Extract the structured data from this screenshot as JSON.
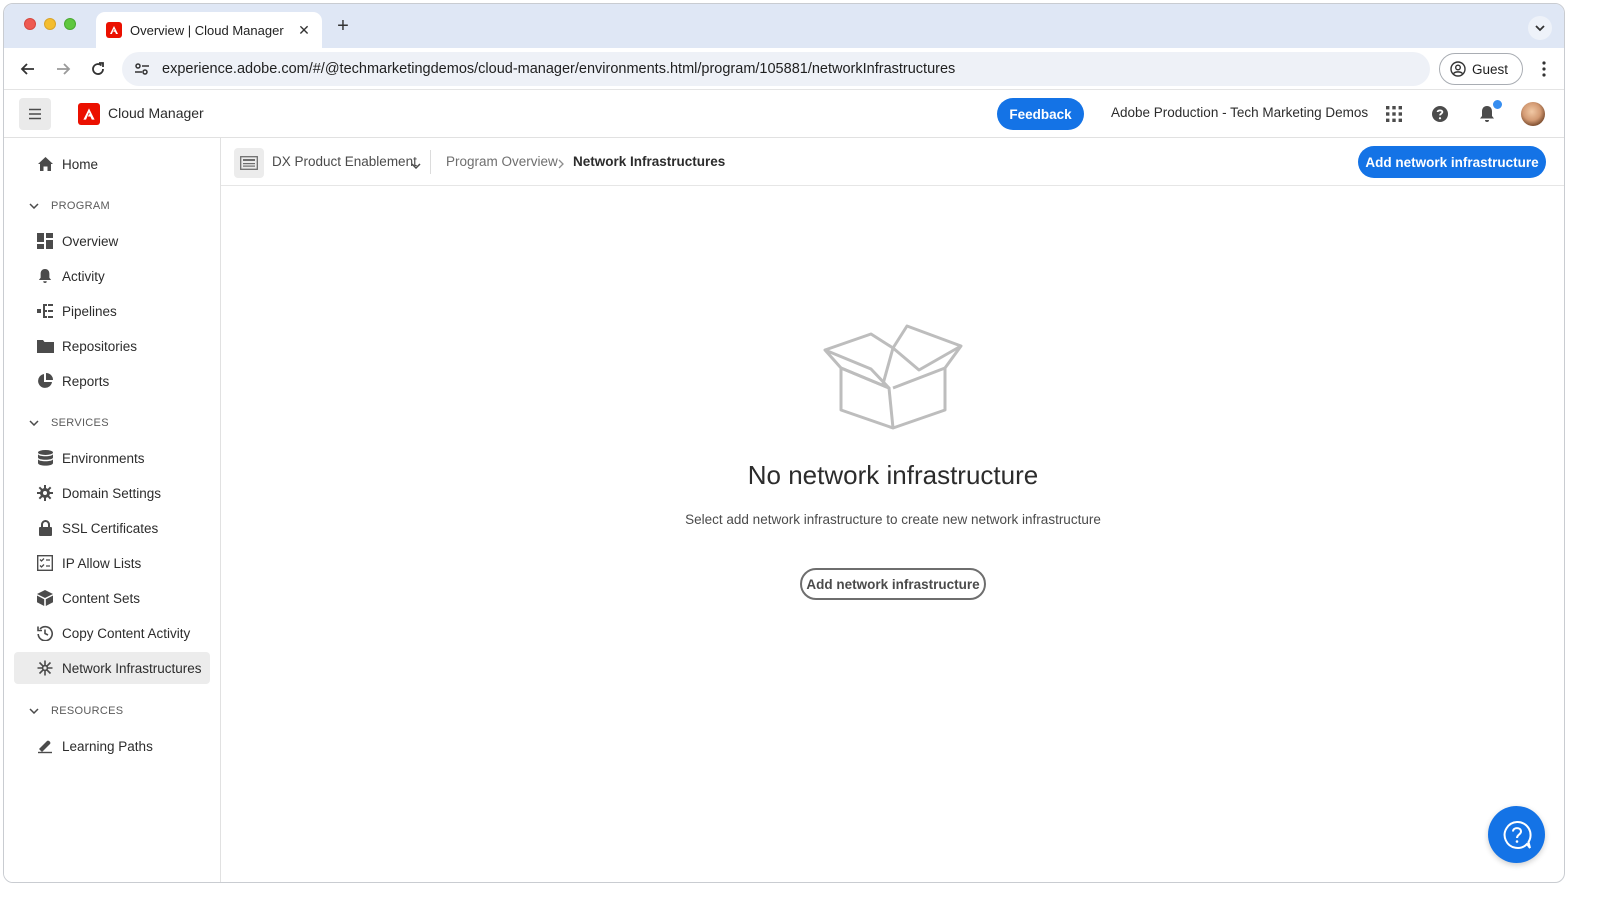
{
  "browser": {
    "tab_title": "Overview | Cloud Manager",
    "url": "experience.adobe.com/#/@techmarketingdemos/cloud-manager/environments.html/program/105881/networkInfrastructures",
    "profile_label": "Guest"
  },
  "header": {
    "brand": "Cloud Manager",
    "feedback_label": "Feedback",
    "org_name": "Adobe Production - Tech Marketing Demos"
  },
  "sidebar": {
    "home": "Home",
    "sections": {
      "program": "PROGRAM",
      "services": "SERVICES",
      "resources": "RESOURCES"
    },
    "program_items": [
      "Overview",
      "Activity",
      "Pipelines",
      "Repositories",
      "Reports"
    ],
    "services_items": [
      "Environments",
      "Domain Settings",
      "SSL Certificates",
      "IP Allow Lists",
      "Content Sets",
      "Copy Content Activity",
      "Network Infrastructures"
    ],
    "resources_items": [
      "Learning Paths"
    ],
    "active_item": "Network Infrastructures"
  },
  "subheader": {
    "program_name": "DX Product Enablement",
    "breadcrumb": [
      "Program Overview",
      "Network Infrastructures"
    ],
    "primary_action": "Add network infrastructure"
  },
  "empty_state": {
    "title": "No network infrastructure",
    "description": "Select add network infrastructure to create new network infrastructure",
    "button_label": "Add network infrastructure"
  },
  "colors": {
    "accent": "#1473e6",
    "adobe_red": "#eb1000",
    "active_nav_bg": "#ececec"
  }
}
